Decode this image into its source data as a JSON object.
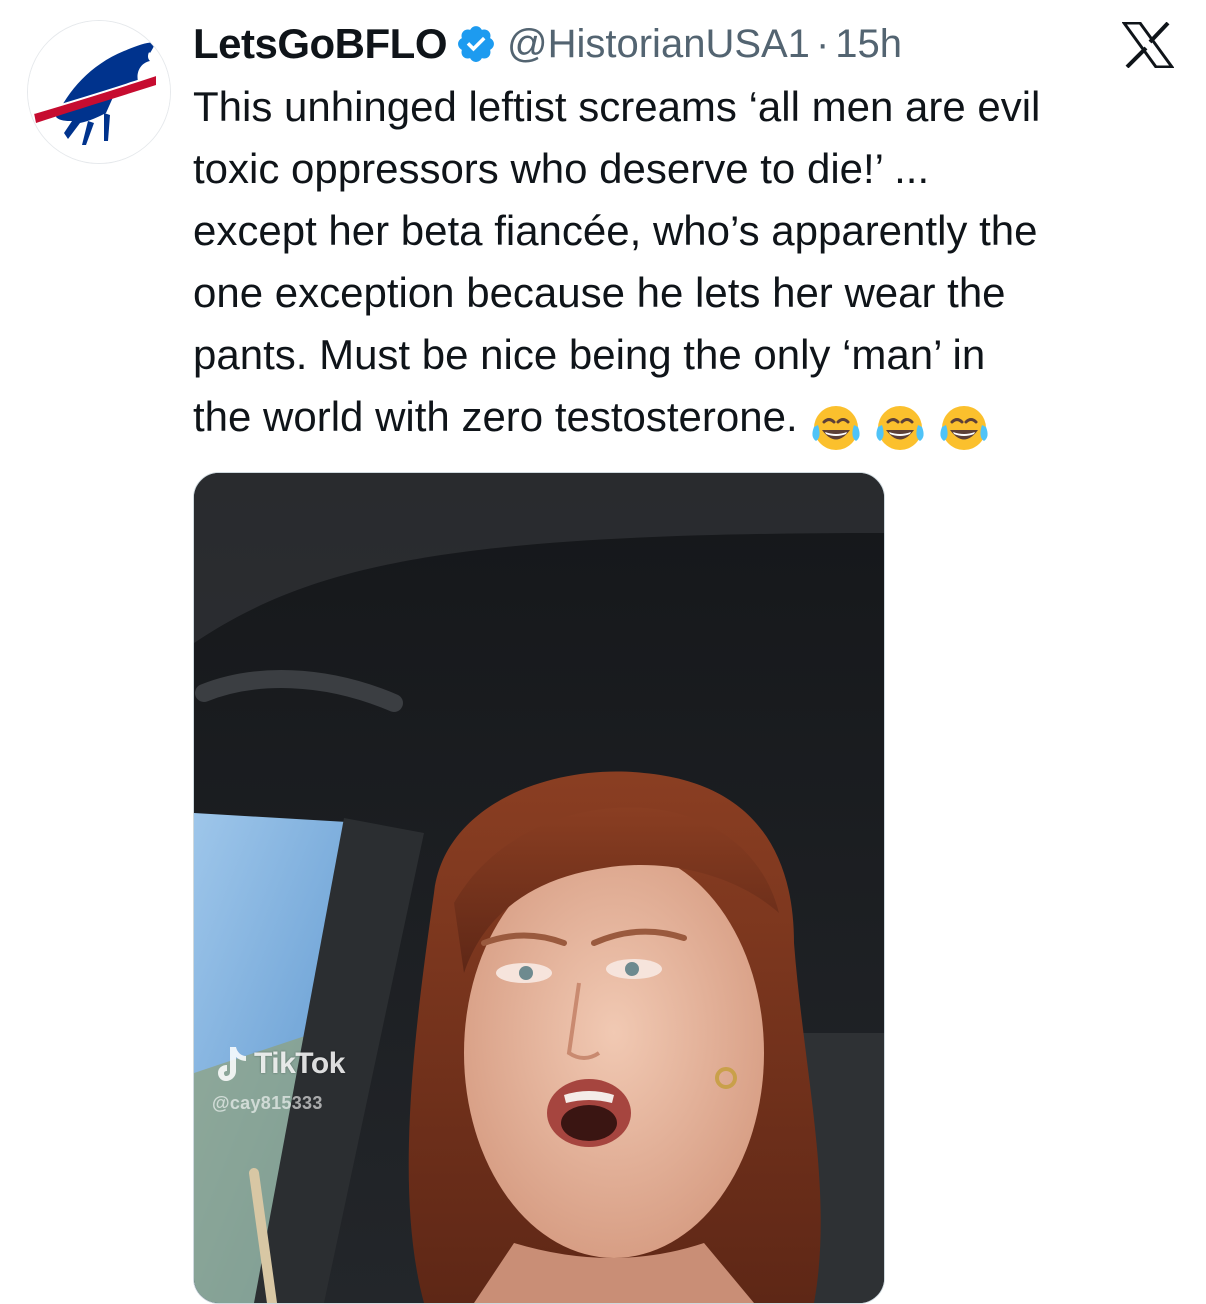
{
  "author": {
    "display_name": "LetsGoBFLO",
    "handle": "@HistorianUSA1",
    "separator": "·",
    "time_ago": "15h",
    "verified": true,
    "avatar_icon": "bills-buffalo-logo-icon"
  },
  "brand": {
    "logo_icon": "x-logo-icon"
  },
  "tweet": {
    "lines": [
      "This unhinged leftist screams ‘all men are evil",
      "toxic oppressors who deserve to die!’ ...",
      "except her beta fiancée, who’s apparently the",
      "one exception because he lets her wear the",
      "pants. Must be nice being the only ‘man’ in",
      "the world with zero testosterone."
    ],
    "emojis": [
      "face-with-tears-of-joy-icon",
      "face-with-tears-of-joy-icon",
      "face-with-tears-of-joy-icon"
    ]
  },
  "media": {
    "type": "video",
    "watermark_brand": "TikTok",
    "watermark_user": "@cay815333"
  },
  "colors": {
    "text_primary": "#0f1419",
    "text_secondary": "#536471",
    "verified_blue": "#1d9bf0",
    "bills_blue": "#00338d",
    "bills_red": "#c60c30"
  }
}
